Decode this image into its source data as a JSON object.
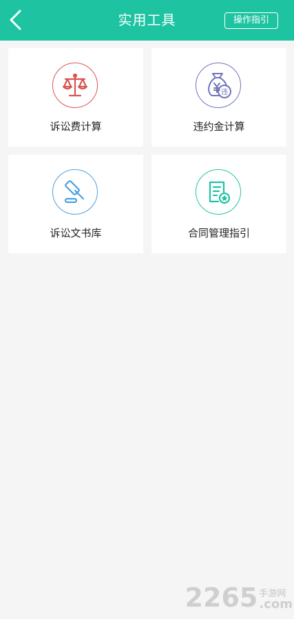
{
  "header": {
    "title": "实用工具",
    "guide_label": "操作指引",
    "background": "#1ec3a2"
  },
  "tools": [
    {
      "label": "诉讼费计算",
      "icon": "scales-icon",
      "color": "#d9534f"
    },
    {
      "label": "违约金计算",
      "icon": "money-bag-icon",
      "color": "#6f72b8"
    },
    {
      "label": "诉讼文书库",
      "icon": "gavel-icon",
      "color": "#4a9fe0"
    },
    {
      "label": "合同管理指引",
      "icon": "contract-icon",
      "color": "#1ec3a2"
    }
  ],
  "watermark": {
    "number": "2265",
    "cn": "手游网",
    "com": ".com"
  }
}
